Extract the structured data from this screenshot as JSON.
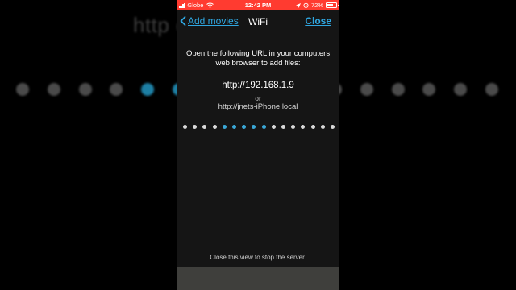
{
  "background": {
    "text": "http://192.168.1.9 or http://jnets-iPhone.local",
    "visible_text": "http                                    ocal"
  },
  "status_bar": {
    "carrier": "Globe",
    "time": "12:42 PM",
    "battery": "72%",
    "battery_level": 0.72,
    "color": "#ff3b30"
  },
  "nav": {
    "back_label": "Add movies",
    "title": "WiFi",
    "close_label": "Close",
    "accent": "#2fa6e0"
  },
  "content": {
    "instructions_line1": "Open the following URL in your computers",
    "instructions_line2": "web browser to add files:",
    "url_primary": "http://192.168.1.9",
    "or": "or",
    "url_secondary": "http://jnets-iPhone.local",
    "footer": "Close this view to stop the server."
  },
  "activity_indicator": {
    "count": 16,
    "highlighted": [
      4,
      5,
      6,
      7,
      8
    ],
    "background_count": 16,
    "background_highlighted": [
      4,
      5
    ]
  }
}
